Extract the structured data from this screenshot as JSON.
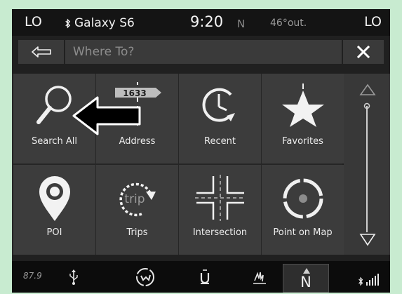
{
  "status": {
    "left_temp_label": "LO",
    "right_temp_label": "LO",
    "device_name": "Galaxy S6",
    "time": "9:20",
    "compass": "N",
    "outside_temp": "46°out."
  },
  "search": {
    "placeholder": "Where To?"
  },
  "tiles": [
    {
      "label": "Search All",
      "icon": "magnifier-icon"
    },
    {
      "label": "Address",
      "icon": "street-sign-icon",
      "badge": "1633"
    },
    {
      "label": "Recent",
      "icon": "clock-history-icon"
    },
    {
      "label": "Favorites",
      "icon": "star-icon"
    },
    {
      "label": "POI",
      "icon": "map-pin-icon"
    },
    {
      "label": "Trips",
      "icon": "trip-icon",
      "badge": "trip"
    },
    {
      "label": "Intersection",
      "icon": "intersection-icon"
    },
    {
      "label": "Point on Map",
      "icon": "point-on-map-icon"
    }
  ],
  "dock": {
    "radio_frequency": "87.9",
    "nav_heading": "N"
  },
  "colors": {
    "background": "#c8ebd0",
    "tile": "#3c3c3c",
    "screen": "#202020",
    "text": "#ececec"
  }
}
